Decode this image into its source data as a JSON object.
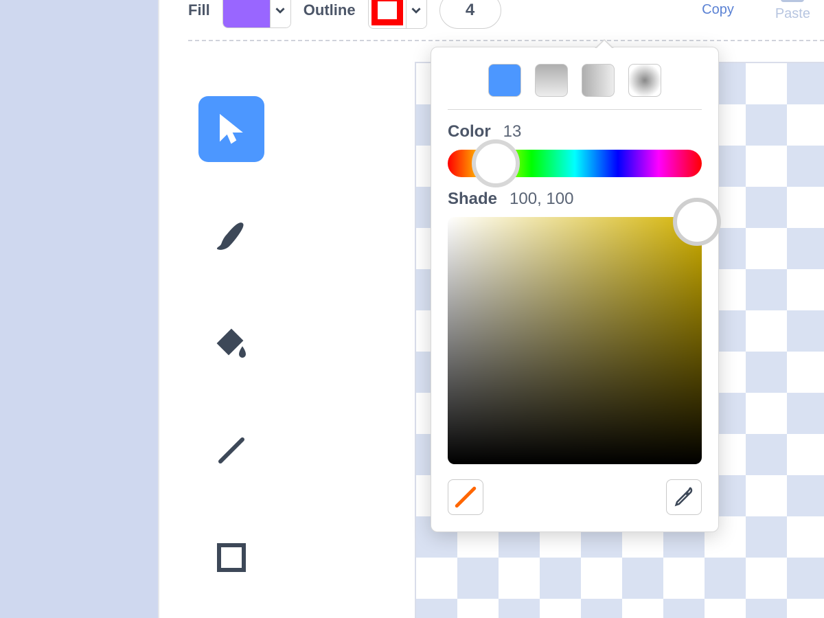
{
  "toolbar": {
    "fill_label": "Fill",
    "outline_label": "Outline",
    "stroke_width": "4",
    "fill_color": "#9966ff",
    "outline_color": "#ff0000",
    "copy_label": "Copy",
    "paste_label": "Paste"
  },
  "picker": {
    "color_label": "Color",
    "color_value": "13",
    "shade_label": "Shade",
    "shade_value": "100, 100"
  },
  "canvas": {
    "dot_color": "#9966ff"
  }
}
